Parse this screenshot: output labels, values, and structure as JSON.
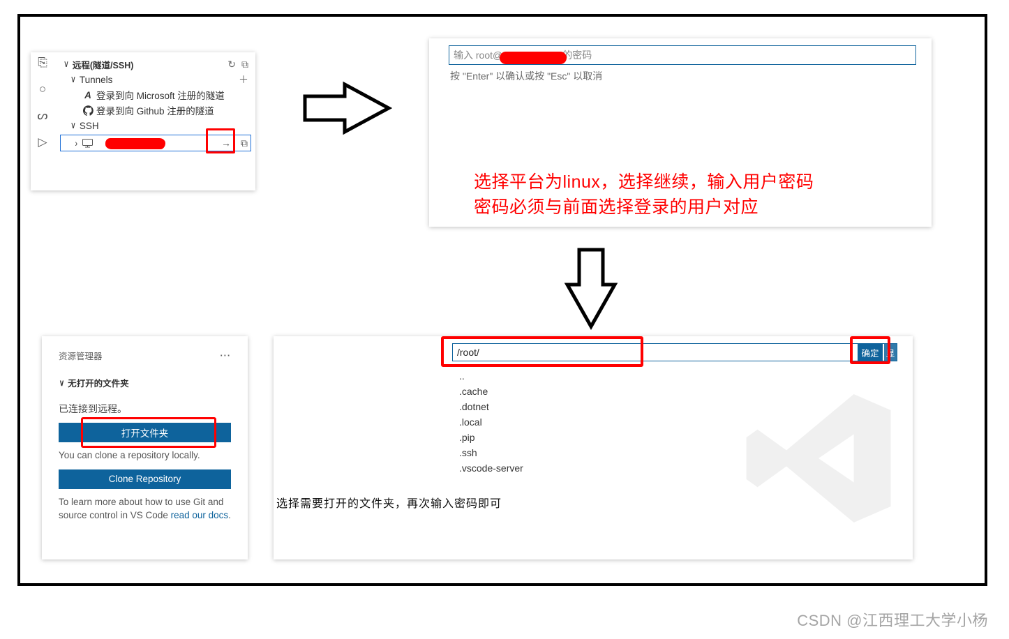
{
  "panel1": {
    "title": "远程(隧道/SSH)",
    "refresh_icon": "↻",
    "new_win_icon": "⧉",
    "tunnels_label": "Tunnels",
    "add_icon": "＋",
    "ms_item": "登录到向 Microsoft 注册的隧道",
    "gh_item": "登录到向 Github 注册的隧道",
    "ssh_label": "SSH",
    "connect_arrow": "→",
    "terminal_icon": "⧉"
  },
  "panel2": {
    "placeholder_prefix": "输入 root@",
    "placeholder_suffix": "的密码",
    "hint": "按 \"Enter\" 以确认或按 \"Esc\" 以取消",
    "red_line1": "选择平台为linux，选择继续，输入用户密码",
    "red_line2": "密码必须与前面选择登录的用户对应"
  },
  "panel3": {
    "header": "资源管理器",
    "ellipsis": "···",
    "no_folder": "无打开的文件夹",
    "connected": "已连接到远程。",
    "open_folder": "打开文件夹",
    "clone_hint": "You can clone a repository locally.",
    "clone_btn": "Clone Repository",
    "learn1": "To learn more about how to use Git and source control in VS Code ",
    "learn_link": "read our docs",
    "learn2": "."
  },
  "panel4": {
    "path": "/root/",
    "ok": "确定",
    "extra": "显",
    "items": [
      "..",
      ".cache",
      ".dotnet",
      ".local",
      ".pip",
      ".ssh",
      ".vscode-server"
    ],
    "caption": "选择需要打开的文件夹，再次输入密码即可"
  },
  "watermark": "CSDN @江西理工大学小杨"
}
